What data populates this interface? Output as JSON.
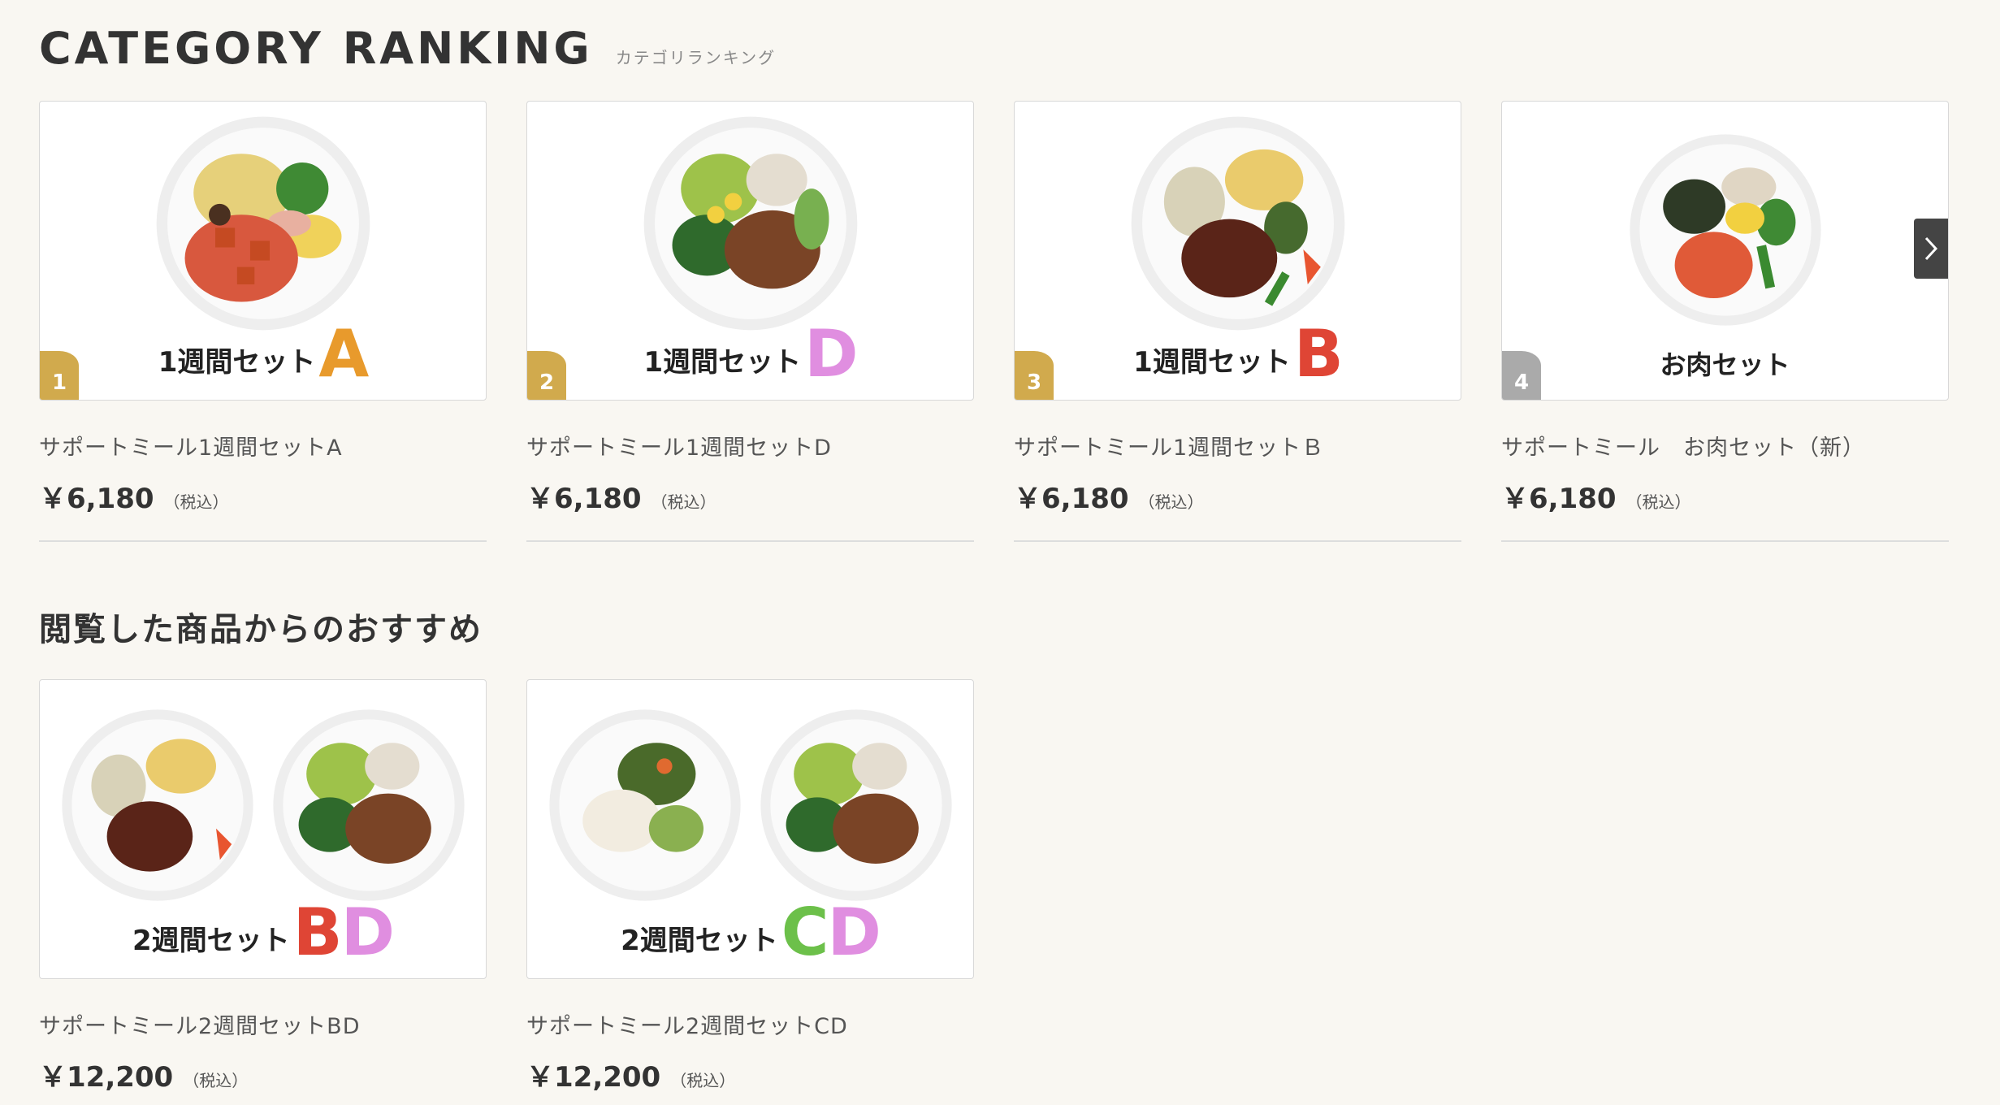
{
  "ranking": {
    "title": "CATEGORY RANKING",
    "subtitle": "カテゴリランキング",
    "items": [
      {
        "rank": "1",
        "caption": "1週間セット",
        "letters": "A",
        "letter_colors": [
          "#e89a2c"
        ],
        "badge_color": "#d1aa4d",
        "name": "サポートミール1週間セットA",
        "price": "￥6,180",
        "tax": "（税込）"
      },
      {
        "rank": "2",
        "caption": "1週間セット",
        "letters": "D",
        "letter_colors": [
          "#e08ee0"
        ],
        "badge_color": "#d1aa4d",
        "name": "サポートミール1週間セットD",
        "price": "￥6,180",
        "tax": "（税込）"
      },
      {
        "rank": "3",
        "caption": "1週間セット",
        "letters": "B",
        "letter_colors": [
          "#df4535"
        ],
        "badge_color": "#d1aa4d",
        "name": "サポートミール1週間セットＢ",
        "price": "￥6,180",
        "tax": "（税込）"
      },
      {
        "rank": "4",
        "caption": "お肉セット",
        "letters": "",
        "letter_colors": [],
        "badge_color": "#aaaaaa",
        "name": "サポートミール　お肉セット（新）",
        "price": "￥6,180",
        "tax": "（税込）"
      }
    ]
  },
  "recommend": {
    "title": "閲覧した商品からのおすすめ",
    "items": [
      {
        "caption": "2週間セット",
        "letters": "BD",
        "letter_colors": [
          "#df4535",
          "#e08ee0"
        ],
        "name": "サポートミール2週間セットBD",
        "price": "￥12,200",
        "tax": "（税込）"
      },
      {
        "caption": "2週間セット",
        "letters": "CD",
        "letter_colors": [
          "#6cc04a",
          "#e08ee0"
        ],
        "name": "サポートミール2週間セットCD",
        "price": "￥12,200",
        "tax": "（税込）"
      }
    ]
  },
  "icons": {
    "next": "chevron-right-icon",
    "plate": "food-plate-image"
  },
  "colors": {
    "background": "#f9f7f2",
    "badge_gold": "#d1aa4d",
    "badge_gray": "#aaaaaa"
  }
}
